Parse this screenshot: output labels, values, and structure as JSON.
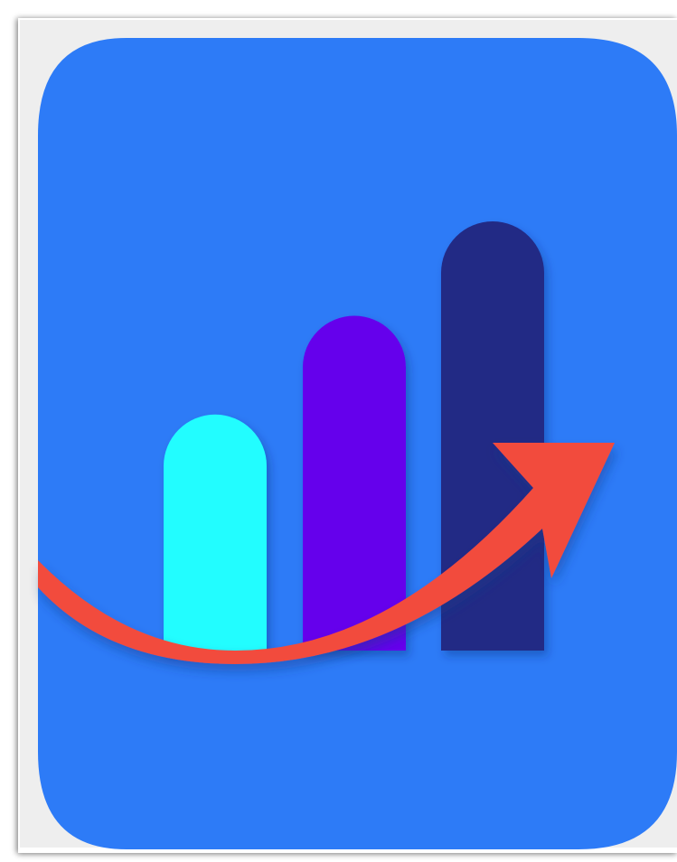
{
  "image": {
    "subject": "growth-chart-icon",
    "icon_name": "bar-chart-trend-up-icon"
  },
  "colors": {
    "page_background": "#ffffff",
    "mat_background": "#eeeeee",
    "tile_background": "#2d7bf7",
    "bar_1": "#22fdff",
    "bar_2": "#6505ec",
    "bar_3": "#222a85",
    "trend_arrow": "#f24b3c"
  },
  "bars": [
    {
      "name": "short",
      "relative_height": 0.55
    },
    {
      "name": "medium",
      "relative_height": 0.78
    },
    {
      "name": "tall",
      "relative_height": 1.0
    }
  ]
}
